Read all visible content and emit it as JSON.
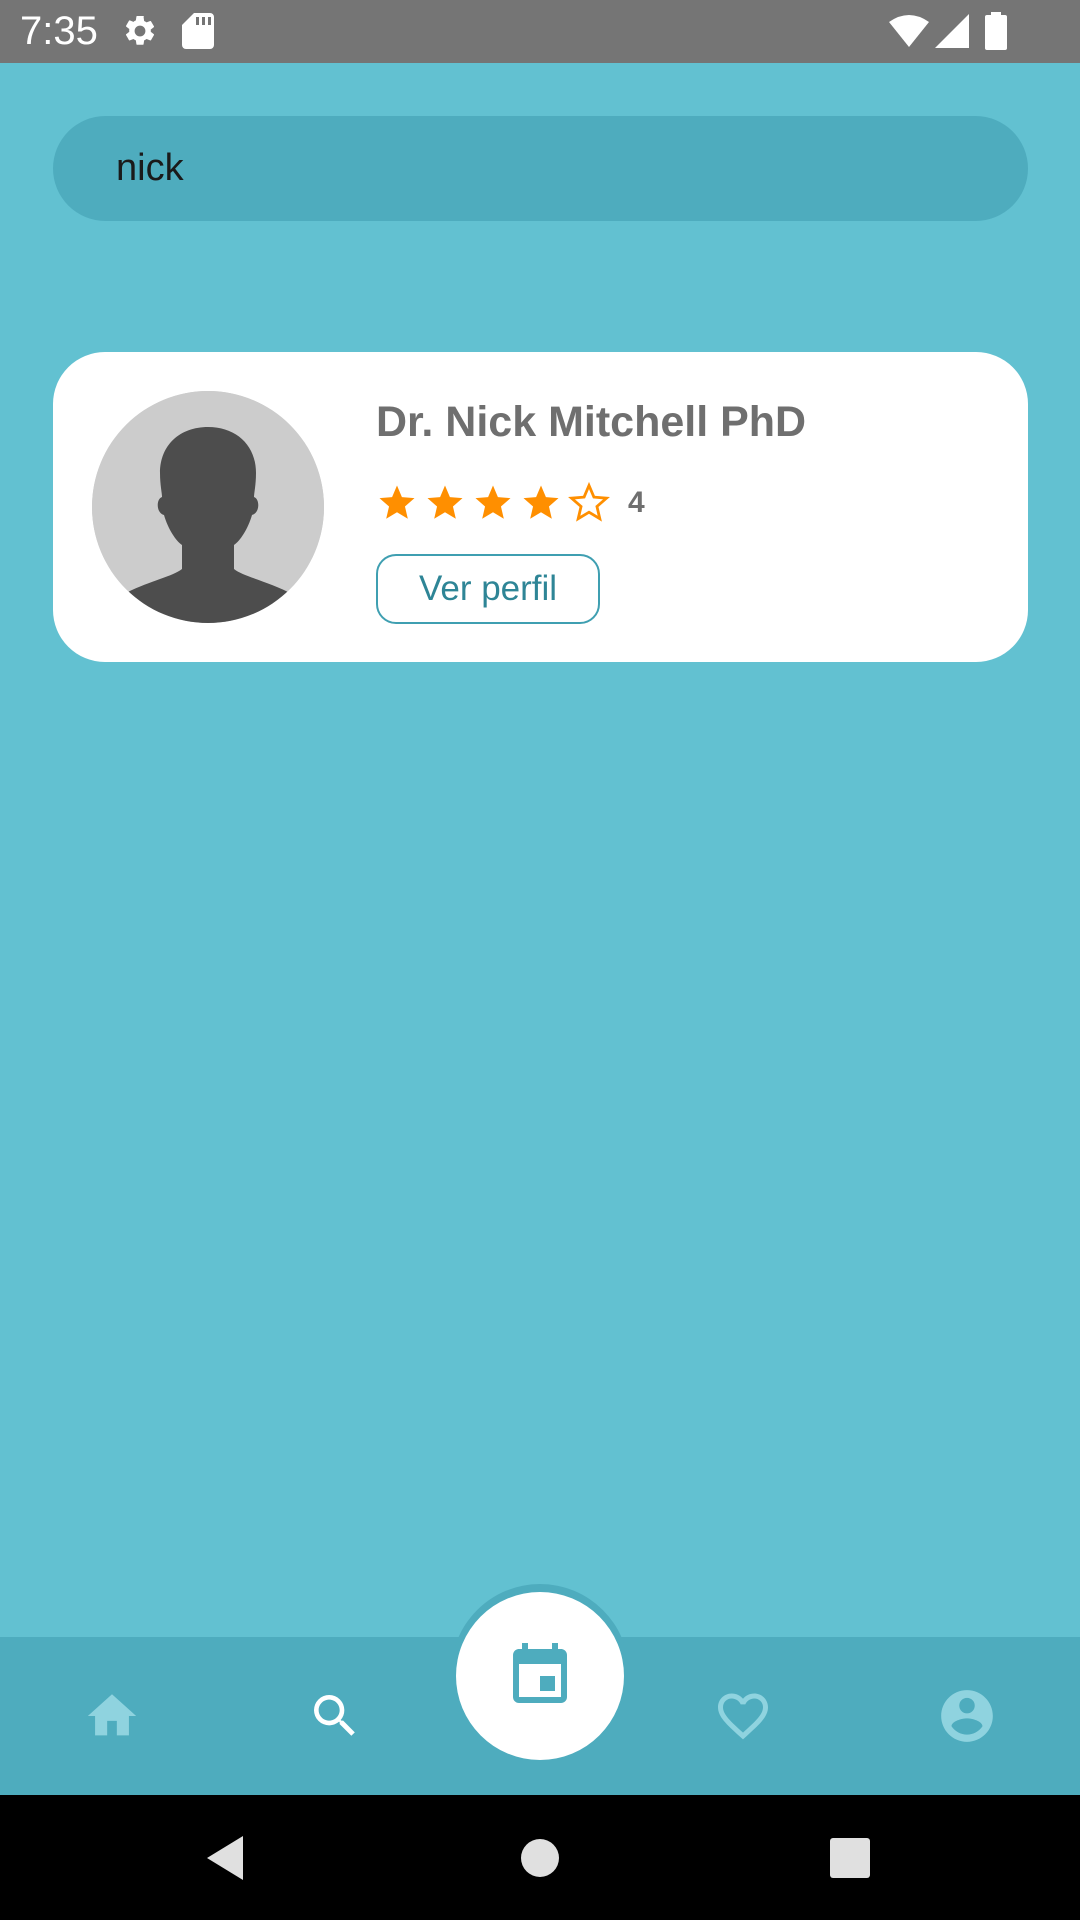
{
  "status_bar": {
    "time": "7:35",
    "icons_left": [
      "settings-icon",
      "sd-card-icon"
    ],
    "icons_right": [
      "wifi-icon",
      "signal-icon",
      "battery-icon"
    ]
  },
  "search": {
    "value": "nick",
    "placeholder": ""
  },
  "results": [
    {
      "name": "Dr. Nick Mitchell PhD",
      "rating": 4,
      "rating_max": 5,
      "rating_label": "4",
      "button_label": "Ver perfil"
    }
  ],
  "bottom_nav": {
    "items": [
      "home-icon",
      "search-icon",
      "calendar-icon",
      "heart-icon",
      "account-icon"
    ],
    "active": "search-icon"
  },
  "colors": {
    "background": "#62c1d1",
    "bar": "#4eacbe",
    "star": "#ff8f00",
    "name_text": "#6f6f6f",
    "accent": "#3f9fb1"
  }
}
